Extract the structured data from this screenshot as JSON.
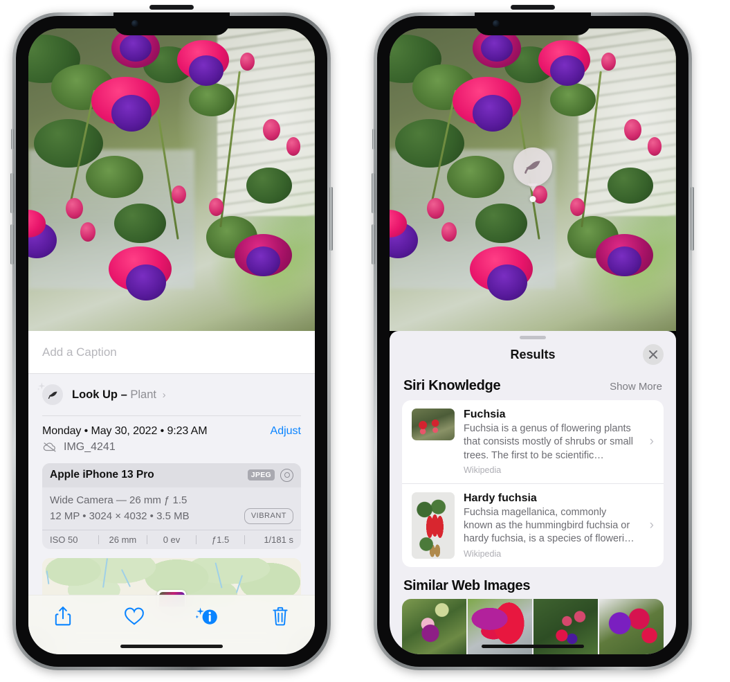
{
  "left_phone": {
    "caption": {
      "placeholder": "Add a Caption",
      "value": ""
    },
    "lookup": {
      "icon": "leaf-icon",
      "sparkle_icon": "sparkle-icon",
      "label": "Look Up –",
      "subject": "Plant",
      "chevron": "›"
    },
    "info": {
      "datetime": "Monday • May 30, 2022 • 9:23 AM",
      "adjust_label": "Adjust",
      "cloud_icon": "cloud-slash-icon",
      "filename": "IMG_4241"
    },
    "exif": {
      "device": "Apple iPhone 13 Pro",
      "format_badge": "JPEG",
      "aperture_icon": "aperture-icon",
      "lens_line": "Wide Camera — 26 mm ƒ 1.5",
      "size_line": "12 MP • 3024 × 4032 • 3.5 MB",
      "style_badge": "VIBRANT",
      "stats": [
        "ISO 50",
        "26 mm",
        "0 ev",
        "ƒ1.5",
        "1/181 s"
      ]
    },
    "map": {
      "name": "location-map-thumbnail",
      "pin": "photo-pin"
    },
    "toolbar": [
      {
        "name": "share-button",
        "icon": "share-icon"
      },
      {
        "name": "favorite-button",
        "icon": "heart-icon"
      },
      {
        "name": "info-button",
        "icon": "info-sparkle-icon"
      },
      {
        "name": "delete-button",
        "icon": "trash-icon"
      }
    ]
  },
  "right_phone": {
    "visual_lookup_badge": {
      "icon": "leaf-icon"
    },
    "sheet": {
      "grabber": "drag-handle",
      "title": "Results",
      "close_icon": "close-icon"
    },
    "siri_knowledge": {
      "title": "Siri Knowledge",
      "action": "Show More",
      "items": [
        {
          "title": "Fuchsia",
          "description": "Fuchsia is a genus of flowering plants that consists mostly of shrubs or small trees. The first to be scientific…",
          "source": "Wikipedia",
          "thumb": "fuchsia-red-flowers-thumb"
        },
        {
          "title": "Hardy fuchsia",
          "description": "Fuchsia magellanica, commonly known as the hummingbird fuchsia or hardy fuchsia, is a species of floweri…",
          "source": "Wikipedia",
          "thumb": "hardy-fuchsia-specimen-thumb"
        }
      ]
    },
    "similar_web_images": {
      "title": "Similar Web Images",
      "items": [
        {
          "name": "web-image-1"
        },
        {
          "name": "web-image-2"
        },
        {
          "name": "web-image-3"
        },
        {
          "name": "web-image-4"
        }
      ]
    }
  },
  "colors": {
    "accent_blue": "#0a84ff",
    "sheet_bg": "#f2f2f6",
    "results_bg": "#f0eff4",
    "secondary_text": "#8e8e93"
  }
}
